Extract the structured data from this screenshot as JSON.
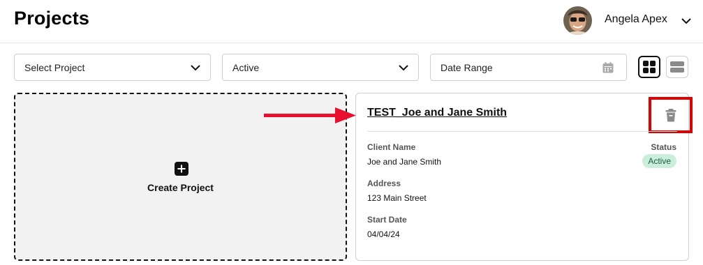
{
  "header": {
    "title": "Projects",
    "user_name": "Angela Apex"
  },
  "filters": {
    "project_select": "Select Project",
    "status_select": "Active",
    "date_range": "Date Range"
  },
  "create_card": {
    "label": "Create Project"
  },
  "project_card": {
    "title": "TEST_Joe and Jane Smith",
    "client_name_label": "Client Name",
    "client_name": "Joe and Jane Smith",
    "status_label": "Status",
    "status": "Active",
    "address_label": "Address",
    "address": "123 Main Street",
    "start_date_label": "Start Date",
    "start_date": "04/04/24"
  },
  "icons": {
    "avatar": "avatar",
    "user_menu": "chevron-down-icon",
    "select": "chevron-down-icon",
    "date_range": "calendar-icon",
    "grid_view": "grid-view-icon",
    "list_view": "list-view-icon",
    "create": "plus-icon",
    "delete": "trash-icon",
    "annotation": "red-arrow-icon"
  },
  "colors": {
    "status_badge_bg": "#c9efdc",
    "annotation_red": "#e00000",
    "arrow_red": "#e8102e"
  }
}
